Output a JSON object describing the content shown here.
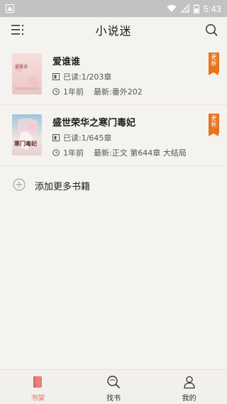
{
  "status_bar": {
    "time": "5:43"
  },
  "app_bar": {
    "title": "小说迷"
  },
  "books": [
    {
      "title": "爱谁谁",
      "cover_text": "爱谁谁",
      "read_progress": "已读:1/203章",
      "updated_time": "1年前",
      "latest_chapter": "最新:番外202",
      "badge": "更新"
    },
    {
      "title": "盛世荣华之寒门毒妃",
      "cover_text": "寒门毒妃",
      "read_progress": "已读:1/645章",
      "updated_time": "1年前",
      "latest_chapter": "最新:正文 第644章 大结局",
      "badge": "更新"
    }
  ],
  "add_more": {
    "label": "添加更多书籍"
  },
  "bottom_nav": [
    {
      "label": "书架",
      "icon": "bookshelf-icon",
      "active": true
    },
    {
      "label": "找书",
      "icon": "find-book-icon",
      "active": false
    },
    {
      "label": "我的",
      "icon": "profile-icon",
      "active": false
    }
  ],
  "colors": {
    "accent": "#e06c6c",
    "badge": "#e8741f",
    "background": "#f5f3f0",
    "status_bar": "#c2c2c2"
  }
}
